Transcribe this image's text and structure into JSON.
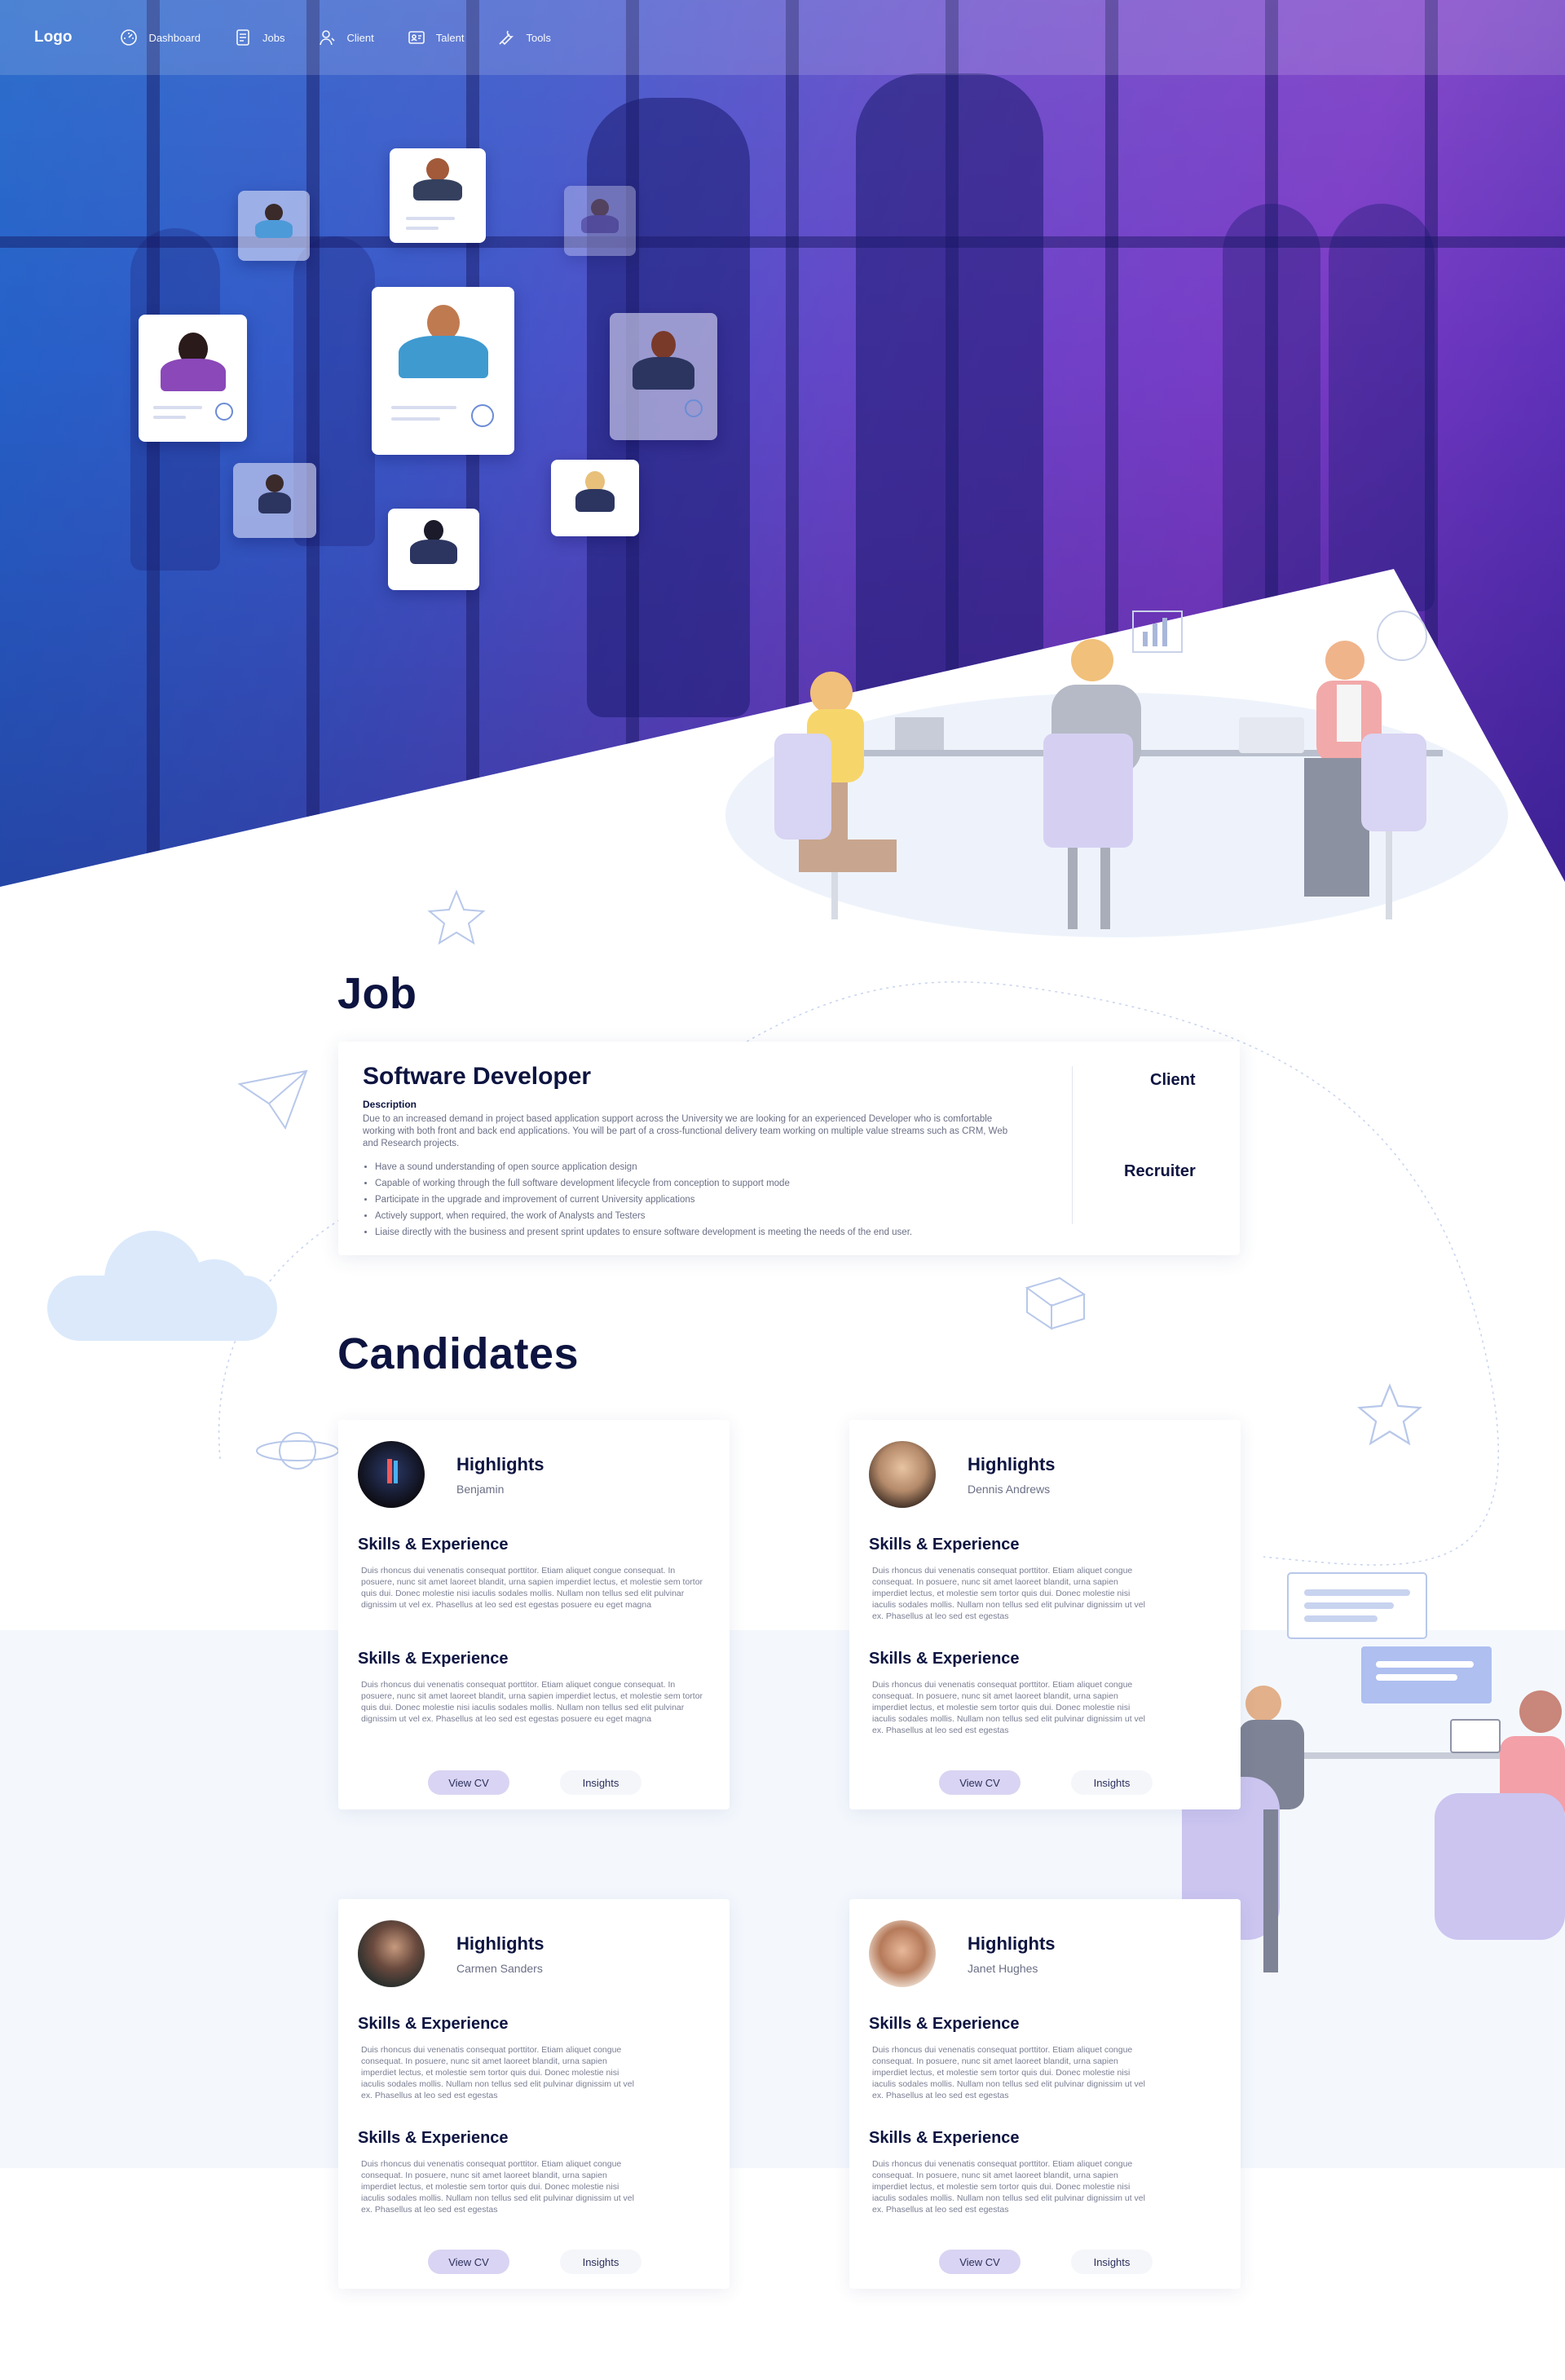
{
  "nav": {
    "logo": "Logo",
    "items": [
      {
        "label": "Dashboard",
        "icon": "dashboard-icon"
      },
      {
        "label": "Jobs",
        "icon": "jobs-icon"
      },
      {
        "label": "Client",
        "icon": "client-icon"
      },
      {
        "label": "Talent",
        "icon": "talent-icon"
      },
      {
        "label": "Tools",
        "icon": "tools-icon"
      }
    ]
  },
  "job": {
    "section_title": "Job",
    "title": "Software Developer",
    "description_label": "Description",
    "description": "Due to an increased demand in project based application support across the University we are looking for an experienced Developer who is comfortable working with both front and back end applications. You will be part of a cross-functional delivery team working on multiple value streams such as CRM, Web and Research projects.",
    "bullets": [
      "Have a sound understanding of open source application design",
      "Capable of working through the full software development lifecycle from conception to support mode",
      "Participate in the upgrade and improvement of current University applications",
      "Actively support, when required, the work of Analysts and Testers",
      "Liaise directly with the business and present sprint updates to ensure software development is meeting the needs of the end user."
    ],
    "client_label": "Client",
    "recruiter_label": "Recruiter"
  },
  "candidates": {
    "section_title": "Candidates",
    "items": [
      {
        "highlights_label": "Highlights",
        "name": "Benjamin",
        "skills_label": "Skills & Experience",
        "skills_text_1": "Duis rhoncus dui venenatis consequat porttitor. Etiam aliquet congue consequat. In posuere, nunc sit amet laoreet blandit, urna sapien imperdiet lectus, et molestie sem tortor quis dui. Donec molestie nisi iaculis sodales mollis. Nullam non tellus sed elit pulvinar dignissim ut vel ex. Phasellus at leo sed est egestas posuere eu eget magna",
        "skills_text_2": "Duis rhoncus dui venenatis consequat porttitor. Etiam aliquet congue consequat. In posuere, nunc sit amet laoreet blandit, urna sapien imperdiet lectus, et molestie sem tortor quis dui. Donec molestie nisi iaculis sodales mollis. Nullam non tellus sed elit pulvinar dignissim ut vel ex. Phasellus at leo sed est egestas posuere eu eget magna",
        "view_cv": "View CV",
        "insights": "Insights",
        "avatar_color": "#1b1b22"
      },
      {
        "highlights_label": "Highlights",
        "name": "Dennis Andrews",
        "skills_label": "Skills & Experience",
        "skills_text_1": "Duis rhoncus dui venenatis consequat porttitor. Etiam aliquet congue consequat. In posuere, nunc sit amet laoreet blandit, urna sapien imperdiet lectus, et molestie sem tortor quis dui. Donec molestie nisi iaculis sodales mollis. Nullam non tellus sed elit pulvinar dignissim ut vel ex. Phasellus at leo sed est egestas",
        "skills_text_2": "Duis rhoncus dui venenatis consequat porttitor. Etiam aliquet congue consequat. In posuere, nunc sit amet laoreet blandit, urna sapien imperdiet lectus, et molestie sem tortor quis dui. Donec molestie nisi iaculis sodales mollis. Nullam non tellus sed elit pulvinar dignissim ut vel ex. Phasellus at leo sed est egestas",
        "view_cv": "View CV",
        "insights": "Insights",
        "avatar_color": "#8a6a52"
      },
      {
        "highlights_label": "Highlights",
        "name": "Carmen Sanders",
        "skills_label": "Skills & Experience",
        "skills_text_1": "Duis rhoncus dui venenatis consequat porttitor. Etiam aliquet congue consequat. In posuere, nunc sit amet laoreet blandit, urna sapien imperdiet lectus, et molestie sem tortor quis dui. Donec molestie nisi iaculis sodales mollis. Nullam non tellus sed elit pulvinar dignissim ut vel ex. Phasellus at leo sed est egestas",
        "skills_text_2": "Duis rhoncus dui venenatis consequat porttitor. Etiam aliquet congue consequat. In posuere, nunc sit amet laoreet blandit, urna sapien imperdiet lectus, et molestie sem tortor quis dui. Donec molestie nisi iaculis sodales mollis. Nullam non tellus sed elit pulvinar dignissim ut vel ex. Phasellus at leo sed est egestas",
        "view_cv": "View CV",
        "insights": "Insights",
        "avatar_color": "#3a2a2a"
      },
      {
        "highlights_label": "Highlights",
        "name": "Janet Hughes",
        "skills_label": "Skills & Experience",
        "skills_text_1": "Duis rhoncus dui venenatis consequat porttitor. Etiam aliquet congue consequat. In posuere, nunc sit amet laoreet blandit, urna sapien imperdiet lectus, et molestie sem tortor quis dui. Donec molestie nisi iaculis sodales mollis. Nullam non tellus sed elit pulvinar dignissim ut vel ex. Phasellus at leo sed est egestas",
        "skills_text_2": "Duis rhoncus dui venenatis consequat porttitor. Etiam aliquet congue consequat. In posuere, nunc sit amet laoreet blandit, urna sapien imperdiet lectus, et molestie sem tortor quis dui. Donec molestie nisi iaculis sodales mollis. Nullam non tellus sed elit pulvinar dignissim ut vel ex. Phasellus at leo sed est egestas",
        "view_cv": "View CV",
        "insights": "Insights",
        "avatar_color": "#c98a6a"
      }
    ]
  },
  "colors": {
    "hero_blue": "#1e63c8",
    "hero_purple": "#6a44c8",
    "heading": "#0d1440",
    "view_cv_bg": "#d9d4f3",
    "insights_bg": "#f5f6fa"
  }
}
